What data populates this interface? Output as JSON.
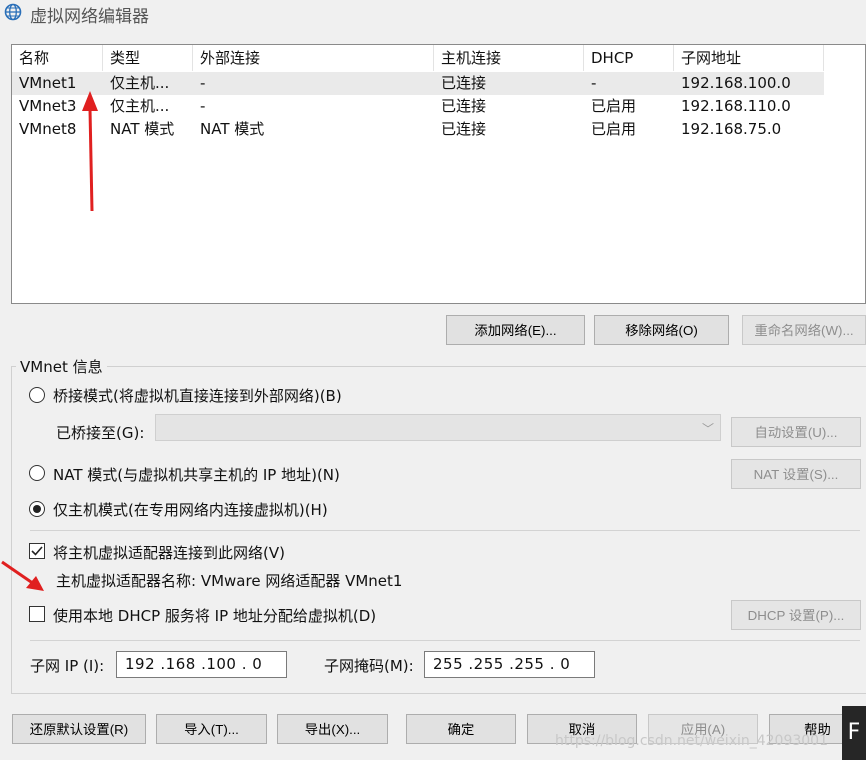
{
  "window": {
    "title": "虚拟网络编辑器",
    "icon": "globe-icon"
  },
  "table": {
    "columns": [
      "名称",
      "类型",
      "外部连接",
      "主机连接",
      "DHCP",
      "子网地址"
    ],
    "rows": [
      [
        "VMnet1",
        "仅主机...",
        "-",
        "已连接",
        "-",
        "192.168.100.0"
      ],
      [
        "VMnet3",
        "仅主机...",
        "-",
        "已连接",
        "已启用",
        "192.168.110.0"
      ],
      [
        "VMnet8",
        "NAT 模式",
        "NAT 模式",
        "已连接",
        "已启用",
        "192.168.75.0"
      ]
    ],
    "selected_row": 0
  },
  "table_buttons": {
    "add": "添加网络(E)...",
    "remove": "移除网络(O)",
    "rename": "重命名网络(W)..."
  },
  "vmnet_info": {
    "title": "VMnet 信息",
    "bridge_label": "桥接模式(将虚拟机直接连接到外部网络)(B)",
    "bridged_to_label": "已桥接至(G):",
    "bridged_to_value": "",
    "auto_settings": "自动设置(U)...",
    "nat_label": "NAT 模式(与虚拟机共享主机的 IP 地址)(N)",
    "nat_settings": "NAT 设置(S)...",
    "hostonly_label": "仅主机模式(在专用网络内连接虚拟机)(H)",
    "selected_mode": "hostonly",
    "connect_adapter_label": "将主机虚拟适配器连接到此网络(V)",
    "connect_adapter_checked": true,
    "adapter_name_text": "主机虚拟适配器名称: VMware 网络适配器 VMnet1",
    "dhcp_label": "使用本地 DHCP 服务将 IP 地址分配给虚拟机(D)",
    "dhcp_checked": false,
    "dhcp_settings": "DHCP 设置(P)...",
    "subnet_ip_label": "子网 IP (I):",
    "subnet_ip_value": "192 .168 .100 .  0",
    "subnet_mask_label": "子网掩码(M):",
    "subnet_mask_value": "255 .255 .255 .  0"
  },
  "bottom_buttons": {
    "restore": "还原默认设置(R)",
    "import": "导入(T)...",
    "export": "导出(X)...",
    "ok": "确定",
    "cancel": "取消",
    "apply": "应用(A)",
    "help": "帮助"
  },
  "watermark": "https://blog.csdn.net/weixin_42093001",
  "corner_glyph": "F",
  "colors": {
    "annotation_arrow": "#e02020",
    "selection": "#eaeaea"
  }
}
